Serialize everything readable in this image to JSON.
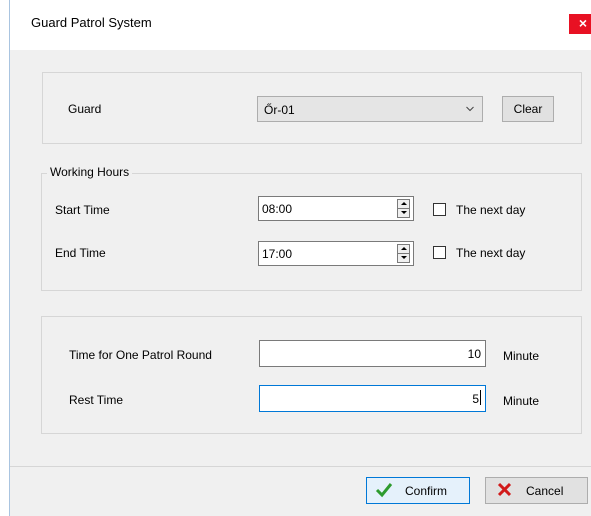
{
  "window": {
    "title": "Guard Patrol System",
    "close_glyph": "×"
  },
  "guard": {
    "label": "Guard",
    "selected": "Őr-01",
    "clear_label": "Clear"
  },
  "working_hours": {
    "group_label": "Working Hours",
    "start": {
      "label": "Start Time",
      "value": "08:00",
      "next_day_label": "The next day",
      "next_day_checked": false
    },
    "end": {
      "label": "End Time",
      "value": "17:00",
      "next_day_label": "The next day",
      "next_day_checked": false
    }
  },
  "patrol": {
    "round_label": "Time for One Patrol Round",
    "round_value": "10",
    "round_unit": "Minute",
    "rest_label": "Rest Time",
    "rest_value": "5",
    "rest_unit": "Minute"
  },
  "footer": {
    "confirm_label": "Confirm",
    "cancel_label": "Cancel"
  },
  "icons": {
    "confirm": "check-icon",
    "cancel": "x-icon"
  },
  "colors": {
    "close_bg": "#e81123",
    "confirm_check": "#2e9b2e",
    "cancel_x": "#d11a1a",
    "focus_border": "#0078d7"
  }
}
